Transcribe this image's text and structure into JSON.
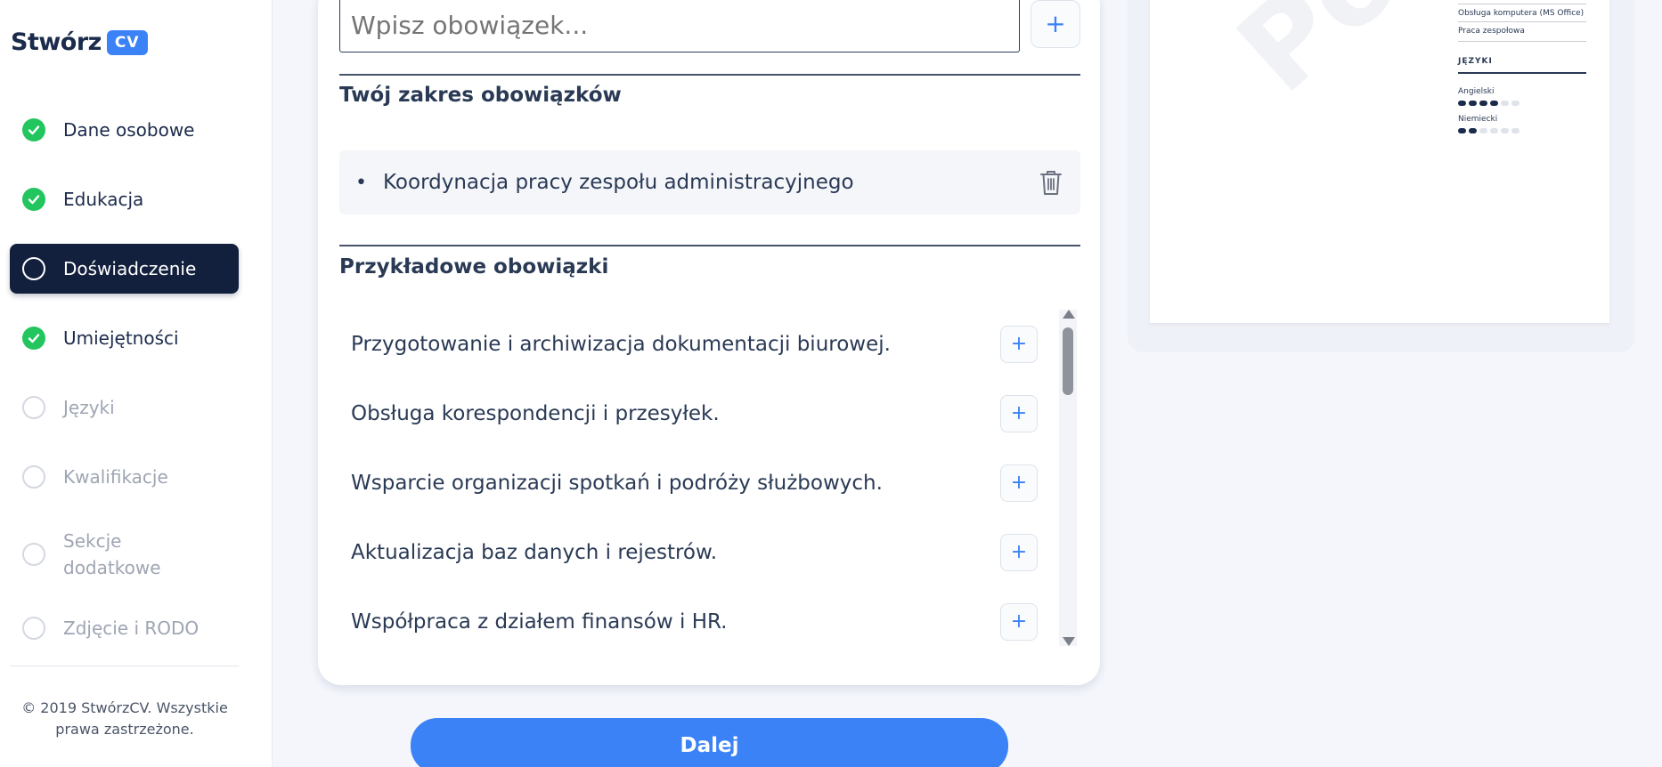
{
  "brand": {
    "name": "Stwórz",
    "badge": "CV"
  },
  "sidebar": {
    "items": [
      {
        "label": "Dane osobowe",
        "status": "done"
      },
      {
        "label": "Edukacja",
        "status": "done"
      },
      {
        "label": "Doświadczenie",
        "status": "current"
      },
      {
        "label": "Umiejętności",
        "status": "done"
      },
      {
        "label": "Języki",
        "status": "todo"
      },
      {
        "label": "Kwalifikacje",
        "status": "todo"
      },
      {
        "label": "Sekcje dodatkowe",
        "status": "todo"
      },
      {
        "label": "Zdjęcie i RODO",
        "status": "todo"
      }
    ],
    "copyright_line1": "© 2019 StwórzCV. Wszystkie",
    "copyright_line2": "prawa zastrzeżone."
  },
  "form": {
    "duty_input_placeholder": "Wpisz obowiązek...",
    "your_duties_title": "Twój zakres obowiązków",
    "your_duties": [
      "Koordynacja pracy zespołu administracyjnego"
    ],
    "examples_title": "Przykładowe obowiązki",
    "examples": [
      "Przygotowanie i archiwizacja dokumentacji biurowej.",
      "Obsługa korespondencji i przesyłek.",
      "Wsparcie organizacji spotkań i podróży służbowych.",
      "Aktualizacja baz danych i rejestrów.",
      "Współpraca z działem finansów i HR."
    ],
    "next_label": "Dalej"
  },
  "preview": {
    "watermark": "Podgląd",
    "skills": [
      "Obsługa komputera (MS Office)",
      "Praca zespołowa"
    ],
    "languages_heading": "JĘZYKI",
    "languages": [
      {
        "name": "Angielski",
        "level": 4,
        "max": 6
      },
      {
        "name": "Niemiecki",
        "level": 2,
        "max": 6
      }
    ]
  },
  "colors": {
    "accent": "#3b82f6",
    "done": "#22c55e",
    "active_bg": "#13203d",
    "text_dark": "#2a3a55"
  }
}
